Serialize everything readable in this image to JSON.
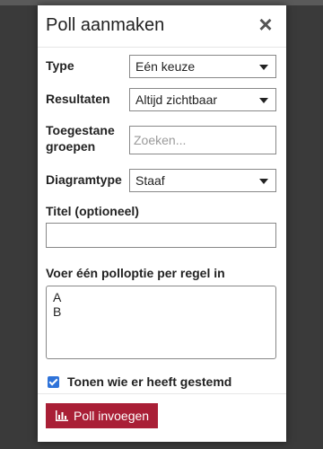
{
  "modal": {
    "title": "Poll aanmaken",
    "close_icon": "close-icon"
  },
  "form": {
    "type": {
      "label": "Type",
      "value": "Eén keuze"
    },
    "results": {
      "label": "Resultaten",
      "value": "Altijd zichtbaar"
    },
    "groups": {
      "label_line1": "Toegestane",
      "label_line2": "groepen",
      "placeholder": "Zoeken..."
    },
    "chart_type": {
      "label": "Diagramtype",
      "value": "Staaf"
    },
    "title": {
      "label": "Titel (optioneel)",
      "value": ""
    },
    "options": {
      "label": "Voer één polloptie per regel in",
      "lines": [
        "A",
        "B"
      ]
    },
    "show_voters": {
      "label": "Tonen wie er heeft gestemd",
      "checked": true
    }
  },
  "footer": {
    "insert_button": {
      "label": "Poll invoegen",
      "icon": "bar-chart-icon"
    }
  },
  "colors": {
    "primary": "#a91f36",
    "checkbox": "#2f73d9"
  }
}
